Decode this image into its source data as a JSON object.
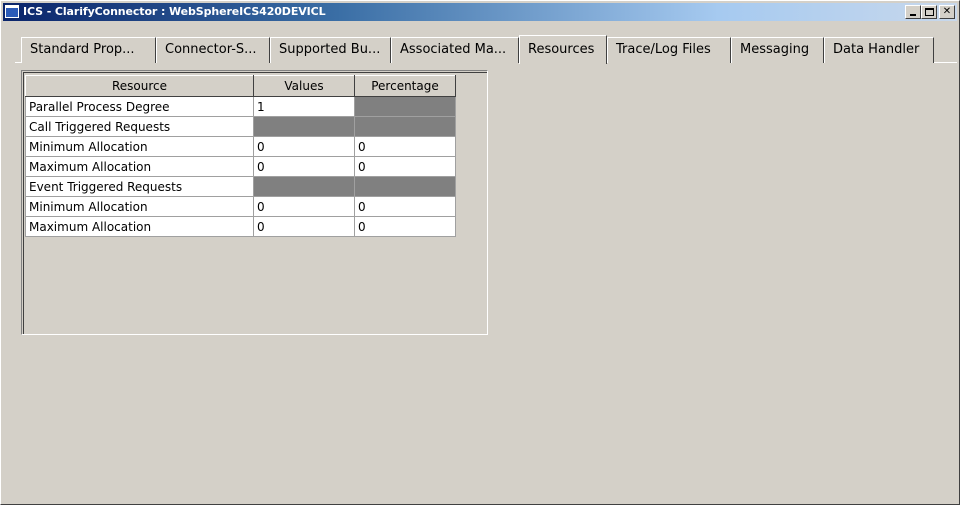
{
  "window": {
    "title": "ICS - ClarifyConnector : WebSphereICS420DEVICL",
    "close_glyph": "✕"
  },
  "tabs": [
    {
      "label": "Standard Prop..."
    },
    {
      "label": "Connector-S..."
    },
    {
      "label": "Supported Bu..."
    },
    {
      "label": "Associated Ma..."
    },
    {
      "label": "Resources",
      "active": true
    },
    {
      "label": "Trace/Log Files"
    },
    {
      "label": "Messaging"
    },
    {
      "label": "Data Handler"
    }
  ],
  "table": {
    "headers": [
      "Resource",
      "Values",
      "Percentage"
    ],
    "rows": [
      {
        "resource": "Parallel Process Degree",
        "value": "1",
        "percentage": ""
      },
      {
        "resource": "Call Triggered Requests",
        "value": "",
        "percentage": ""
      },
      {
        "resource": "Minimum Allocation",
        "value": "0",
        "percentage": "0"
      },
      {
        "resource": "Maximum Allocation",
        "value": "0",
        "percentage": "0"
      },
      {
        "resource": "Event Triggered Requests",
        "value": "",
        "percentage": ""
      },
      {
        "resource": "Minimum Allocation",
        "value": "0",
        "percentage": "0"
      },
      {
        "resource": "Maximum Allocation",
        "value": "0",
        "percentage": "0"
      }
    ]
  },
  "colors": {
    "title_gradient_start": "#0a246a",
    "title_gradient_end": "#a6caf0",
    "window_face": "#d4d0c8",
    "disabled_cell": "#808080"
  }
}
